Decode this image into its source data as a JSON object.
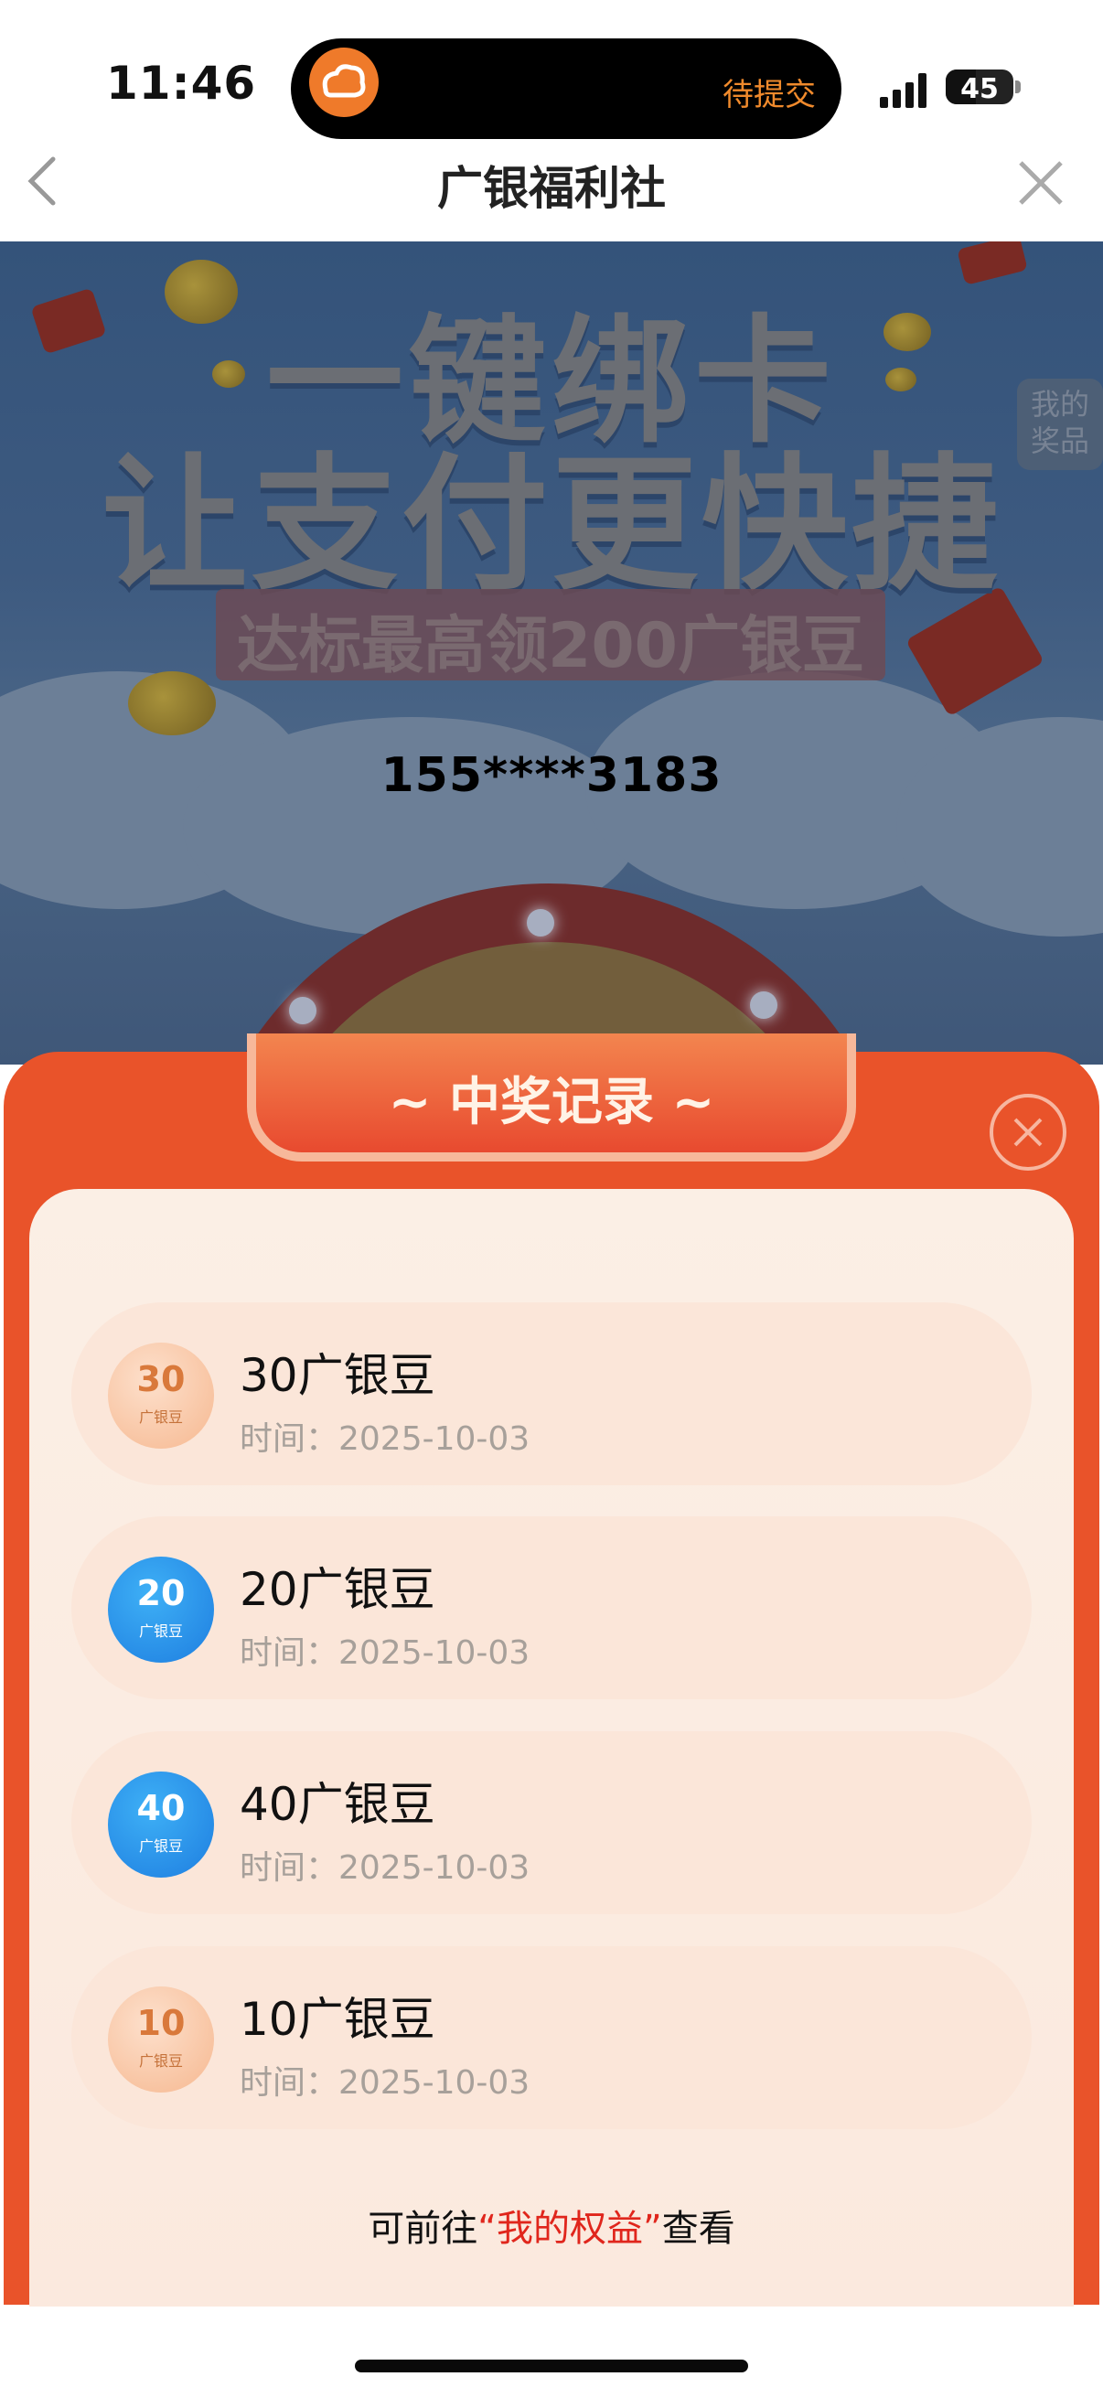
{
  "status_bar": {
    "time": "11:46",
    "island_text": "待提交",
    "battery": "45",
    "battery_level": 0.45
  },
  "nav": {
    "title": "广银福利社",
    "back_icon": "chevron-left-icon",
    "close_icon": "close-icon"
  },
  "banner": {
    "title_line1": "一键绑卡",
    "title_line2": "让支付更快捷",
    "subtitle": "达标最高领200广银豆",
    "my_prize_label": "我的奖品",
    "phone": "155****3183"
  },
  "modal": {
    "title": "~ 中奖记录 ~",
    "records": [
      {
        "amount": "30",
        "unit": "广银豆",
        "title": "30广银豆",
        "time": "时间：2025-10-03",
        "style": "orange"
      },
      {
        "amount": "20",
        "unit": "广银豆",
        "title": "20广银豆",
        "time": "时间：2025-10-03",
        "style": "blue"
      },
      {
        "amount": "40",
        "unit": "广银豆",
        "title": "40广银豆",
        "time": "时间：2025-10-03",
        "style": "blue"
      },
      {
        "amount": "10",
        "unit": "广银豆",
        "title": "10广银豆",
        "time": "时间：2025-10-03",
        "style": "orange"
      }
    ],
    "tip_prefix": "可前往",
    "tip_link": "“我的权益”",
    "tip_suffix": "查看"
  },
  "colors": {
    "accent": "#e9532a",
    "link": "#e0261c",
    "badge_blue": "#1e8ee8",
    "badge_orange": "#f6b890"
  }
}
